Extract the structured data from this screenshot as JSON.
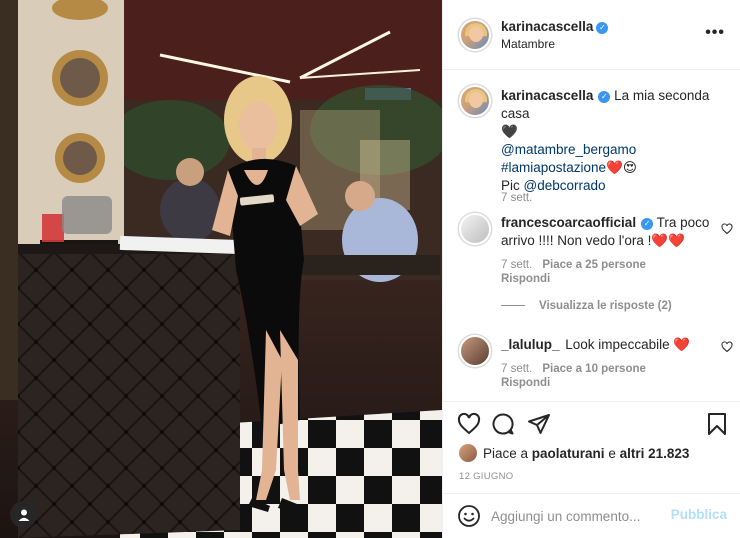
{
  "post": {
    "author": "karinacascella",
    "location": "Matambre",
    "caption": {
      "text": "La mia seconda casa",
      "heart": "🖤",
      "mention": "@matambre_bergamo",
      "hashtag": "#lamiapostazione",
      "hashtag_emojis": "❤️😍",
      "credit_prefix": "Pic",
      "credit_mention": "@debcorrado",
      "time": "7 sett."
    },
    "comments": [
      {
        "username": "francescoarcaofficial",
        "verified": true,
        "text": "Tra poco arrivo !!!! Non vedo l'ora !",
        "emojis": "❤️❤️",
        "time": "7 sett.",
        "likes": "Piace a 25 persone",
        "reply": "Rispondi",
        "view_replies": "Visualizza le risposte (2)"
      },
      {
        "username": "_lalulup_",
        "verified": false,
        "text": "Look impeccabile",
        "emojis": "❤️",
        "time": "7 sett.",
        "likes": "Piace a 10 persone",
        "reply": "Rispondi"
      }
    ],
    "likes": {
      "prefix": "Piace a",
      "user": "paolaturani",
      "middle": "e",
      "others": "altri 21.823"
    },
    "date": "12 GIUGNO"
  },
  "comment_box": {
    "placeholder": "Aggiungi un commento...",
    "publish_label": "Pubblica"
  },
  "icons": {
    "more": "more-options-icon",
    "like": "heart-icon",
    "comment": "comment-icon",
    "share": "share-icon",
    "save": "bookmark-icon",
    "emoji": "emoji-icon",
    "tags": "user-tag-icon"
  },
  "colors": {
    "verified": "#3897f0",
    "heart": "#ed4956",
    "publish_disabled": "#b2dffc",
    "link": "#00376b"
  }
}
